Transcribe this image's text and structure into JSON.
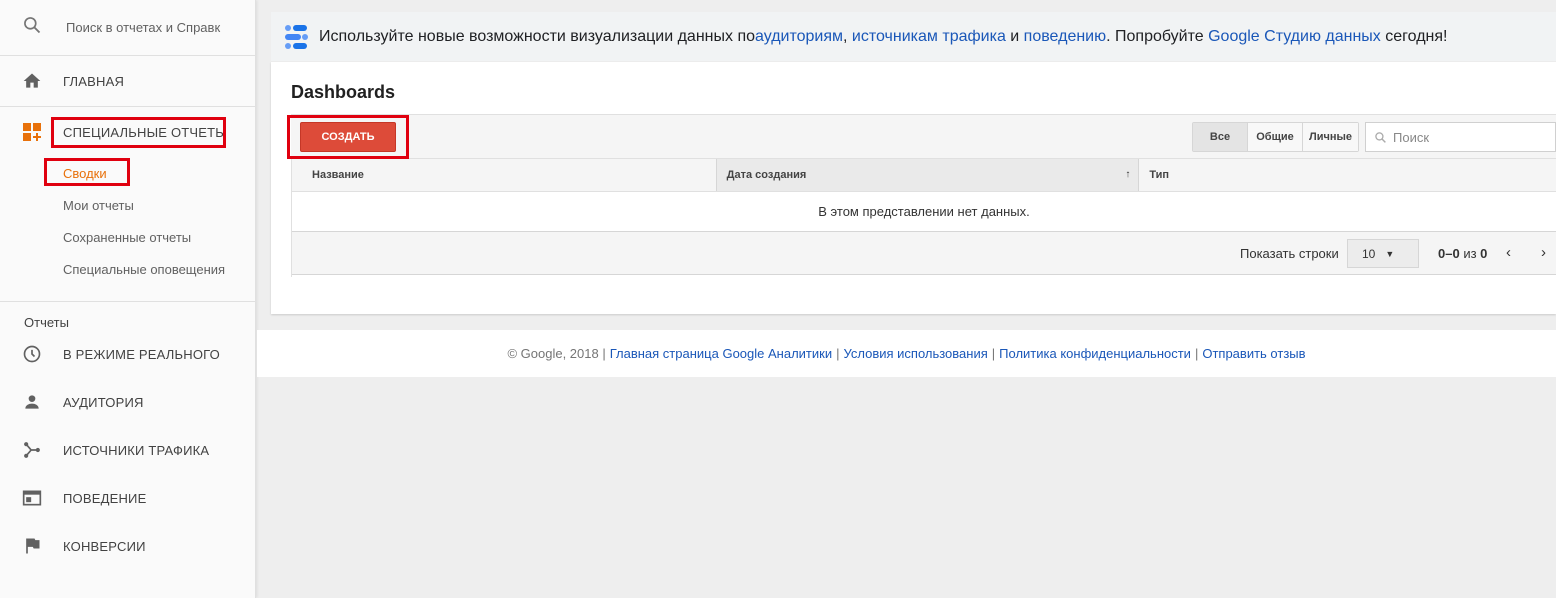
{
  "sidebar": {
    "search_placeholder": "Поиск в отчетах и Справк",
    "home": "ГЛАВНАЯ",
    "custom_reports": "СПЕЦИАЛЬНЫЕ ОТЧЕТЫ",
    "sub_items": [
      "Сводки",
      "Мои отчеты",
      "Сохраненные отчеты",
      "Специальные оповещения"
    ],
    "reports_label": "Отчеты",
    "report_items": [
      "В РЕЖИМЕ РЕАЛЬНОГО",
      "АУДИТОРИЯ",
      "ИСТОЧНИКИ ТРАФИКА",
      "ПОВЕДЕНИЕ",
      "КОНВЕРСИИ"
    ]
  },
  "banner": {
    "text_1": "Используйте новые возможности визуализации данных по ",
    "link_1": "аудиториям",
    "text_2": ", ",
    "link_2": "источникам трафика",
    "text_3": " и ",
    "link_3": "поведению",
    "text_4": ". Попробуйте ",
    "link_4": "Google Студию данных",
    "text_5": " сегодня!"
  },
  "dashboards": {
    "title": "Dashboards",
    "create_label": "СОЗДАТЬ",
    "filters": [
      "Все",
      "Общие",
      "Личные"
    ],
    "search_placeholder": "Поиск",
    "columns": [
      "Название",
      "Дата создания",
      "Тип"
    ],
    "sort_arrow": "↑",
    "empty_text": "В этом представлении нет данных.",
    "rows_label": "Показать строки",
    "rows_value": "10",
    "range_bold": "0–0",
    "range_of": " из ",
    "range_total": "0"
  },
  "footer": {
    "copyright": "© Google, 2018 |",
    "links": [
      "Главная страница Google Аналитики",
      "Условия использования",
      "Политика конфиденциальности",
      "Отправить отзыв"
    ]
  },
  "colors": {
    "accent_orange": "#e8710a",
    "create_red": "#dd4b39",
    "highlight_red": "#e0000f",
    "link_blue": "#1a57b8"
  }
}
